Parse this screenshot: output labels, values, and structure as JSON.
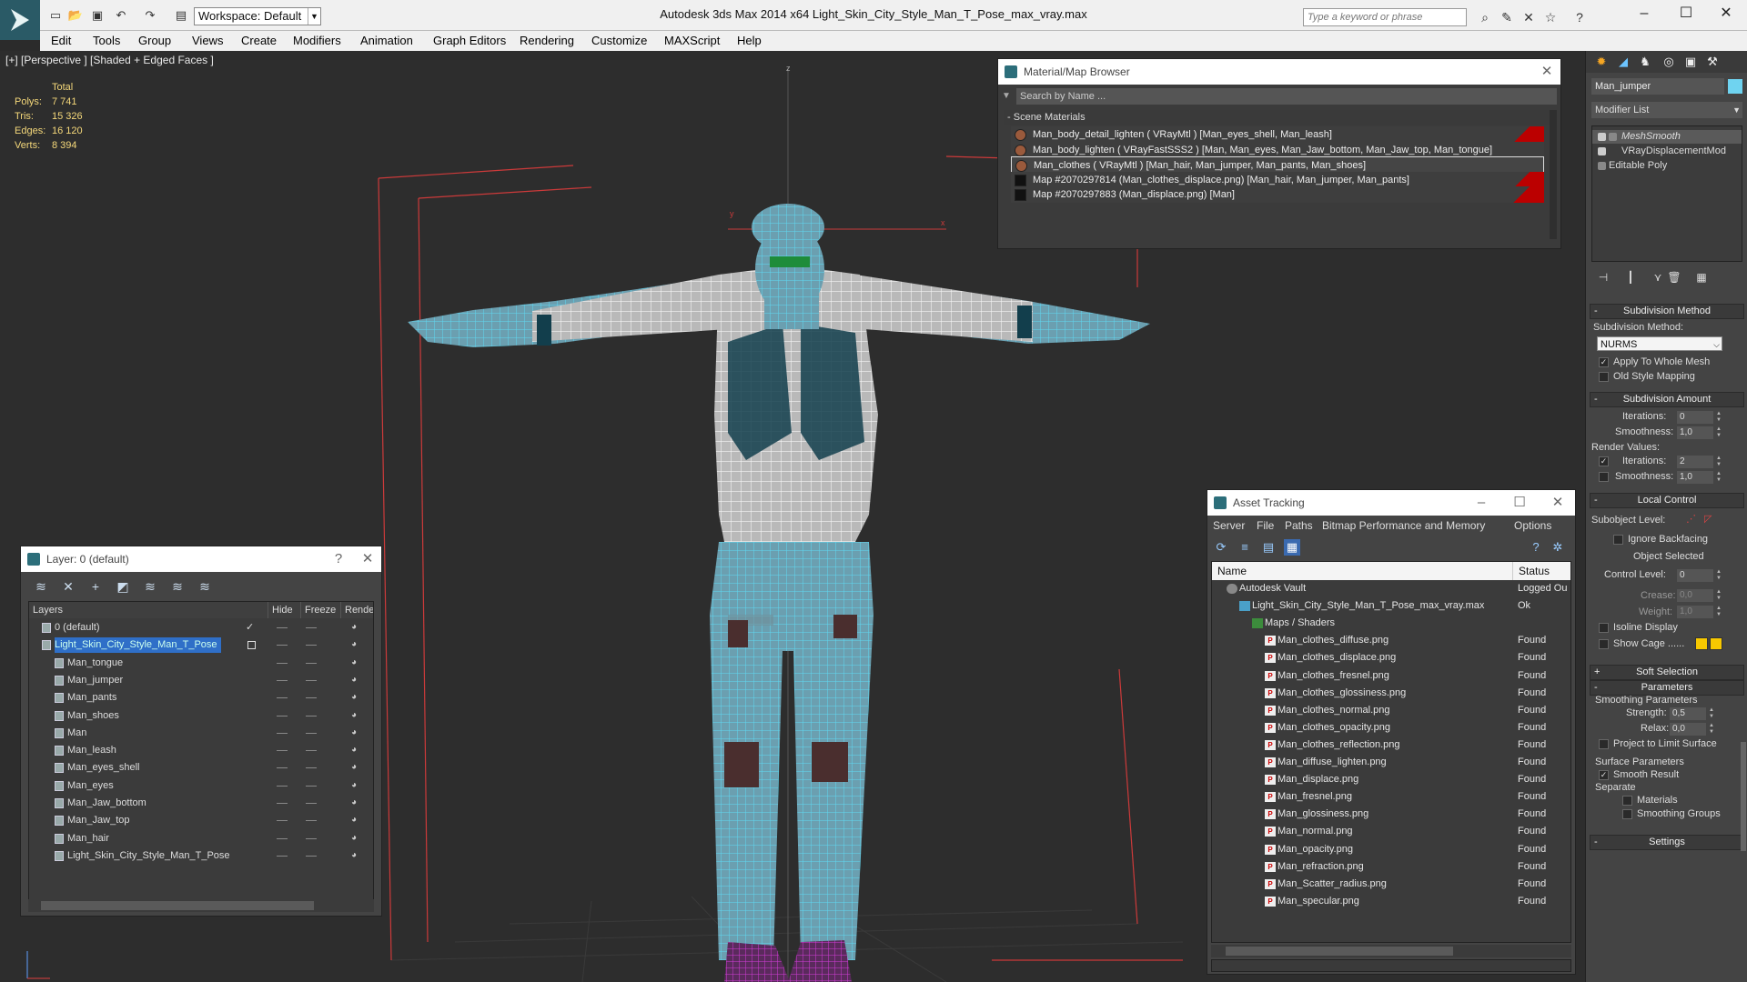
{
  "title_bar": {
    "workspace_label": "Workspace: Default",
    "window_title": "Autodesk 3ds Max  2014 x64      Light_Skin_City_Style_Man_T_Pose_max_vray.max",
    "search_placeholder": "Type a keyword or phrase"
  },
  "menu": [
    "Edit",
    "Tools",
    "Group",
    "Views",
    "Create",
    "Modifiers",
    "Animation",
    "Graph Editors",
    "Rendering",
    "Customize",
    "MAXScript",
    "Help"
  ],
  "viewport": {
    "label": "[+] [Perspective ] [Shaded + Edged Faces ]",
    "stats_header": "Total",
    "stats": [
      {
        "label": "Polys:",
        "value": "7 741"
      },
      {
        "label": "Tris:",
        "value": "15 326"
      },
      {
        "label": "Edges:",
        "value": "16 120"
      },
      {
        "label": "Verts:",
        "value": "8 394"
      }
    ],
    "axis_z": "z",
    "axis_x": "x",
    "axis_y": "y"
  },
  "material_browser": {
    "title": "Material/Map Browser",
    "search_placeholder": "Search by Name ...",
    "group": "Scene Materials",
    "rows": [
      {
        "text": "Man_body_detail_lighten  ( VRayMtl ) [Man_eyes_shell, Man_leash]",
        "kind": "material",
        "flag": true
      },
      {
        "text": "Man_body_lighten  ( VRayFastSSS2 ) [Man, Man_eyes, Man_Jaw_bottom, Man_Jaw_top, Man_tongue]",
        "kind": "material",
        "flag": false
      },
      {
        "text": "Man_clothes  ( VRayMtl ) [Man_hair, Man_jumper, Man_pants, Man_shoes]",
        "kind": "material",
        "flag": false,
        "selected": true
      },
      {
        "text": "Map #2070297814 (Man_clothes_displace.png) [Man_hair, Man_jumper, Man_pants]",
        "kind": "map",
        "flag": true
      },
      {
        "text": "Map #2070297883 (Man_displace.png) [Man]",
        "kind": "map",
        "flag": true
      }
    ]
  },
  "layer_panel": {
    "title": "Layer: 0 (default)",
    "help": "?",
    "columns": [
      "Layers",
      "Hide",
      "Freeze",
      "Rende"
    ],
    "rows": [
      {
        "name": "0 (default)",
        "indent": 0,
        "check": "✓"
      },
      {
        "name": "Light_Skin_City_Style_Man_T_Pose",
        "indent": 0,
        "selected": true
      },
      {
        "name": "Man_tongue",
        "indent": 1
      },
      {
        "name": "Man_jumper",
        "indent": 1
      },
      {
        "name": "Man_pants",
        "indent": 1
      },
      {
        "name": "Man_shoes",
        "indent": 1
      },
      {
        "name": "Man",
        "indent": 1
      },
      {
        "name": "Man_leash",
        "indent": 1
      },
      {
        "name": "Man_eyes_shell",
        "indent": 1
      },
      {
        "name": "Man_eyes",
        "indent": 1
      },
      {
        "name": "Man_Jaw_bottom",
        "indent": 1
      },
      {
        "name": "Man_Jaw_top",
        "indent": 1
      },
      {
        "name": "Man_hair",
        "indent": 1
      },
      {
        "name": "Light_Skin_City_Style_Man_T_Pose",
        "indent": 1
      }
    ]
  },
  "asset_tracking": {
    "title": "Asset Tracking",
    "menu": [
      "Server",
      "File",
      "Paths",
      "Bitmap Performance and Memory",
      "Options"
    ],
    "columns": {
      "name": "Name",
      "status": "Status"
    },
    "rows": [
      {
        "name": "Autodesk Vault",
        "status": "Logged Ou",
        "level": 0,
        "icon": "vault-icon"
      },
      {
        "name": "Light_Skin_City_Style_Man_T_Pose_max_vray.max",
        "status": "Ok",
        "level": 1,
        "icon": "max-file-icon"
      },
      {
        "name": "Maps / Shaders",
        "status": "",
        "level": 2,
        "icon": "maps-icon"
      },
      {
        "name": "Man_clothes_diffuse.png",
        "status": "Found",
        "level": 3,
        "icon": "png-icon"
      },
      {
        "name": "Man_clothes_displace.png",
        "status": "Found",
        "level": 3,
        "icon": "png-icon"
      },
      {
        "name": "Man_clothes_fresnel.png",
        "status": "Found",
        "level": 3,
        "icon": "png-icon"
      },
      {
        "name": "Man_clothes_glossiness.png",
        "status": "Found",
        "level": 3,
        "icon": "png-icon"
      },
      {
        "name": "Man_clothes_normal.png",
        "status": "Found",
        "level": 3,
        "icon": "png-icon"
      },
      {
        "name": "Man_clothes_opacity.png",
        "status": "Found",
        "level": 3,
        "icon": "png-icon"
      },
      {
        "name": "Man_clothes_reflection.png",
        "status": "Found",
        "level": 3,
        "icon": "png-icon"
      },
      {
        "name": "Man_diffuse_lighten.png",
        "status": "Found",
        "level": 3,
        "icon": "png-icon"
      },
      {
        "name": "Man_displace.png",
        "status": "Found",
        "level": 3,
        "icon": "png-icon"
      },
      {
        "name": "Man_fresnel.png",
        "status": "Found",
        "level": 3,
        "icon": "png-icon"
      },
      {
        "name": "Man_glossiness.png",
        "status": "Found",
        "level": 3,
        "icon": "png-icon"
      },
      {
        "name": "Man_normal.png",
        "status": "Found",
        "level": 3,
        "icon": "png-icon"
      },
      {
        "name": "Man_opacity.png",
        "status": "Found",
        "level": 3,
        "icon": "png-icon"
      },
      {
        "name": "Man_refraction.png",
        "status": "Found",
        "level": 3,
        "icon": "png-icon"
      },
      {
        "name": "Man_Scatter_radius.png",
        "status": "Found",
        "level": 3,
        "icon": "png-icon"
      },
      {
        "name": "Man_specular.png",
        "status": "Found",
        "level": 3,
        "icon": "png-icon"
      }
    ]
  },
  "command_panel": {
    "object_name": "Man_jumper",
    "modifier_list": "Modifier List",
    "stack": [
      "MeshSmooth",
      "VRayDisplacementMod",
      "Editable Poly"
    ],
    "subdivision_method": {
      "title": "Subdivision Method",
      "label": "Subdivision Method:",
      "value": "NURMS",
      "apply_whole": "Apply To Whole Mesh",
      "old_style": "Old Style Mapping"
    },
    "subdivision_amount": {
      "title": "Subdivision Amount",
      "iterations_label": "Iterations:",
      "iterations": "0",
      "smoothness_label": "Smoothness:",
      "smoothness": "1,0",
      "render_values": "Render Values:",
      "render_iterations": "2",
      "render_smoothness": "1,0"
    },
    "local_control": {
      "title": "Local Control",
      "subobject_level": "Subobject Level:",
      "ignore_backfacing": "Ignore Backfacing",
      "object_selected": "Object Selected",
      "control_level_label": "Control Level:",
      "control_level": "0",
      "crease_label": "Crease:",
      "crease": "0,0",
      "weight_label": "Weight:",
      "weight": "1,0",
      "isoline": "Isoline Display",
      "show_cage": "Show Cage ......"
    },
    "soft_selection": "Soft Selection",
    "parameters": {
      "title": "Parameters",
      "smoothing_params": "Smoothing Parameters",
      "strength_label": "Strength:",
      "strength": "0,5",
      "relax_label": "Relax:",
      "relax": "0,0",
      "project_limit": "Project to Limit Surface",
      "surface_params": "Surface Parameters",
      "smooth_result": "Smooth Result",
      "separate": "Separate",
      "materials": "Materials",
      "smoothing_groups": "Smoothing Groups"
    },
    "settings": "Settings"
  },
  "colors": {
    "wire_cyan": "#5fd8f2",
    "wire_white": "#f0f0f0",
    "shoe_magenta": "#d23cd8",
    "stats_yellow": "#f5d87a",
    "selection_blue": "#2f6fc8"
  }
}
